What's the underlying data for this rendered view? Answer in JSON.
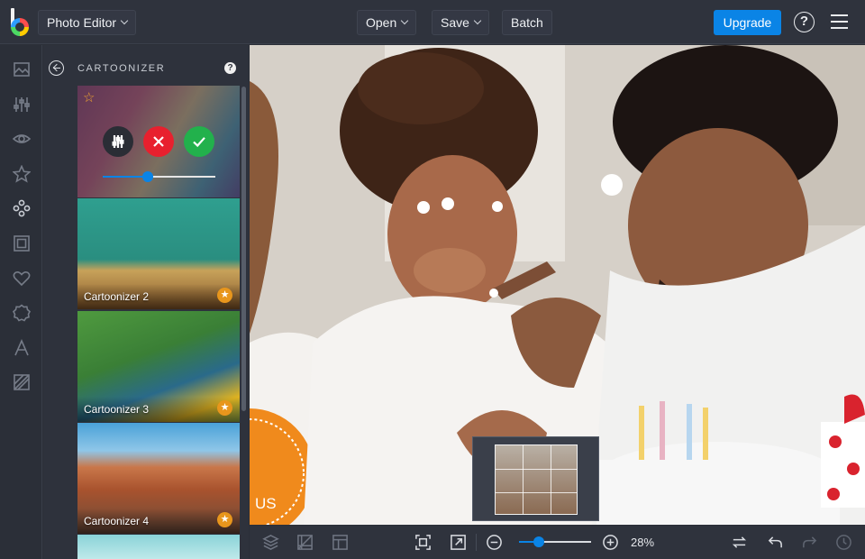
{
  "header": {
    "app_menu_label": "Photo Editor",
    "open_label": "Open",
    "save_label": "Save",
    "batch_label": "Batch",
    "upgrade_label": "Upgrade",
    "help_glyph": "?"
  },
  "rail": {
    "icons": [
      "image-icon",
      "adjust-sliders-icon",
      "eye-icon",
      "star-icon",
      "effects-icon",
      "frame-icon",
      "heart-icon",
      "badge-icon",
      "text-icon",
      "texture-icon"
    ]
  },
  "panel": {
    "title": "CARTOONIZER",
    "help_glyph": "?",
    "active_effect": {
      "strength": 0.4
    },
    "effects": [
      {
        "label": "Cartoonizer 2",
        "premium": true
      },
      {
        "label": "Cartoonizer 3",
        "premium": true
      },
      {
        "label": "Cartoonizer 4",
        "premium": true
      }
    ]
  },
  "canvas": {
    "overlay_text": "US"
  },
  "footer": {
    "zoom_text": "28%",
    "zoom_level": 0.28
  },
  "colors": {
    "accent": "#0a84e6",
    "cancel": "#e8202e",
    "apply": "#22b14c",
    "premium": "#e8961c"
  }
}
